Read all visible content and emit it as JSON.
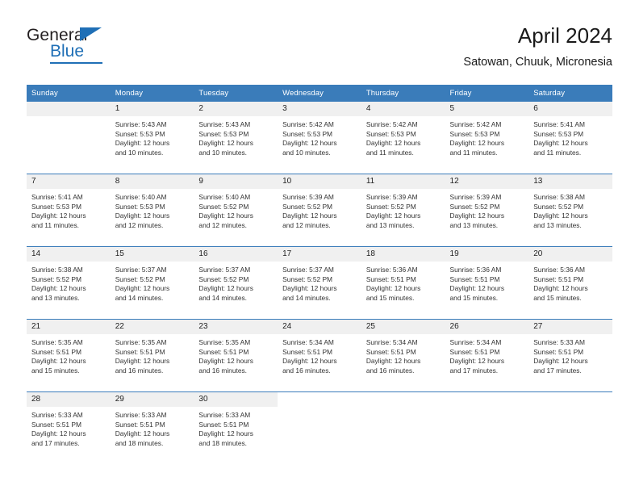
{
  "brand": {
    "word_top": "General",
    "word_bottom": "Blue",
    "triangle_color": "#1f6fb6"
  },
  "header": {
    "title": "April 2024",
    "subtitle": "Satowan, Chuuk, Micronesia"
  },
  "theme": {
    "header_blue": "#3a7cba",
    "daynum_band": "#f0f0f0",
    "text": "#222222"
  },
  "weekdays": [
    "Sunday",
    "Monday",
    "Tuesday",
    "Wednesday",
    "Thursday",
    "Friday",
    "Saturday"
  ],
  "weeks": [
    [
      {
        "day": "",
        "sunrise": "",
        "sunset": "",
        "daylight_line1": "",
        "daylight_line2": "",
        "empty": true
      },
      {
        "day": "1",
        "sunrise": "Sunrise: 5:43 AM",
        "sunset": "Sunset: 5:53 PM",
        "daylight_line1": "Daylight: 12 hours",
        "daylight_line2": "and 10 minutes."
      },
      {
        "day": "2",
        "sunrise": "Sunrise: 5:43 AM",
        "sunset": "Sunset: 5:53 PM",
        "daylight_line1": "Daylight: 12 hours",
        "daylight_line2": "and 10 minutes."
      },
      {
        "day": "3",
        "sunrise": "Sunrise: 5:42 AM",
        "sunset": "Sunset: 5:53 PM",
        "daylight_line1": "Daylight: 12 hours",
        "daylight_line2": "and 10 minutes."
      },
      {
        "day": "4",
        "sunrise": "Sunrise: 5:42 AM",
        "sunset": "Sunset: 5:53 PM",
        "daylight_line1": "Daylight: 12 hours",
        "daylight_line2": "and 11 minutes."
      },
      {
        "day": "5",
        "sunrise": "Sunrise: 5:42 AM",
        "sunset": "Sunset: 5:53 PM",
        "daylight_line1": "Daylight: 12 hours",
        "daylight_line2": "and 11 minutes."
      },
      {
        "day": "6",
        "sunrise": "Sunrise: 5:41 AM",
        "sunset": "Sunset: 5:53 PM",
        "daylight_line1": "Daylight: 12 hours",
        "daylight_line2": "and 11 minutes."
      }
    ],
    [
      {
        "day": "7",
        "sunrise": "Sunrise: 5:41 AM",
        "sunset": "Sunset: 5:53 PM",
        "daylight_line1": "Daylight: 12 hours",
        "daylight_line2": "and 11 minutes."
      },
      {
        "day": "8",
        "sunrise": "Sunrise: 5:40 AM",
        "sunset": "Sunset: 5:53 PM",
        "daylight_line1": "Daylight: 12 hours",
        "daylight_line2": "and 12 minutes."
      },
      {
        "day": "9",
        "sunrise": "Sunrise: 5:40 AM",
        "sunset": "Sunset: 5:52 PM",
        "daylight_line1": "Daylight: 12 hours",
        "daylight_line2": "and 12 minutes."
      },
      {
        "day": "10",
        "sunrise": "Sunrise: 5:39 AM",
        "sunset": "Sunset: 5:52 PM",
        "daylight_line1": "Daylight: 12 hours",
        "daylight_line2": "and 12 minutes."
      },
      {
        "day": "11",
        "sunrise": "Sunrise: 5:39 AM",
        "sunset": "Sunset: 5:52 PM",
        "daylight_line1": "Daylight: 12 hours",
        "daylight_line2": "and 13 minutes."
      },
      {
        "day": "12",
        "sunrise": "Sunrise: 5:39 AM",
        "sunset": "Sunset: 5:52 PM",
        "daylight_line1": "Daylight: 12 hours",
        "daylight_line2": "and 13 minutes."
      },
      {
        "day": "13",
        "sunrise": "Sunrise: 5:38 AM",
        "sunset": "Sunset: 5:52 PM",
        "daylight_line1": "Daylight: 12 hours",
        "daylight_line2": "and 13 minutes."
      }
    ],
    [
      {
        "day": "14",
        "sunrise": "Sunrise: 5:38 AM",
        "sunset": "Sunset: 5:52 PM",
        "daylight_line1": "Daylight: 12 hours",
        "daylight_line2": "and 13 minutes."
      },
      {
        "day": "15",
        "sunrise": "Sunrise: 5:37 AM",
        "sunset": "Sunset: 5:52 PM",
        "daylight_line1": "Daylight: 12 hours",
        "daylight_line2": "and 14 minutes."
      },
      {
        "day": "16",
        "sunrise": "Sunrise: 5:37 AM",
        "sunset": "Sunset: 5:52 PM",
        "daylight_line1": "Daylight: 12 hours",
        "daylight_line2": "and 14 minutes."
      },
      {
        "day": "17",
        "sunrise": "Sunrise: 5:37 AM",
        "sunset": "Sunset: 5:52 PM",
        "daylight_line1": "Daylight: 12 hours",
        "daylight_line2": "and 14 minutes."
      },
      {
        "day": "18",
        "sunrise": "Sunrise: 5:36 AM",
        "sunset": "Sunset: 5:51 PM",
        "daylight_line1": "Daylight: 12 hours",
        "daylight_line2": "and 15 minutes."
      },
      {
        "day": "19",
        "sunrise": "Sunrise: 5:36 AM",
        "sunset": "Sunset: 5:51 PM",
        "daylight_line1": "Daylight: 12 hours",
        "daylight_line2": "and 15 minutes."
      },
      {
        "day": "20",
        "sunrise": "Sunrise: 5:36 AM",
        "sunset": "Sunset: 5:51 PM",
        "daylight_line1": "Daylight: 12 hours",
        "daylight_line2": "and 15 minutes."
      }
    ],
    [
      {
        "day": "21",
        "sunrise": "Sunrise: 5:35 AM",
        "sunset": "Sunset: 5:51 PM",
        "daylight_line1": "Daylight: 12 hours",
        "daylight_line2": "and 15 minutes."
      },
      {
        "day": "22",
        "sunrise": "Sunrise: 5:35 AM",
        "sunset": "Sunset: 5:51 PM",
        "daylight_line1": "Daylight: 12 hours",
        "daylight_line2": "and 16 minutes."
      },
      {
        "day": "23",
        "sunrise": "Sunrise: 5:35 AM",
        "sunset": "Sunset: 5:51 PM",
        "daylight_line1": "Daylight: 12 hours",
        "daylight_line2": "and 16 minutes."
      },
      {
        "day": "24",
        "sunrise": "Sunrise: 5:34 AM",
        "sunset": "Sunset: 5:51 PM",
        "daylight_line1": "Daylight: 12 hours",
        "daylight_line2": "and 16 minutes."
      },
      {
        "day": "25",
        "sunrise": "Sunrise: 5:34 AM",
        "sunset": "Sunset: 5:51 PM",
        "daylight_line1": "Daylight: 12 hours",
        "daylight_line2": "and 16 minutes."
      },
      {
        "day": "26",
        "sunrise": "Sunrise: 5:34 AM",
        "sunset": "Sunset: 5:51 PM",
        "daylight_line1": "Daylight: 12 hours",
        "daylight_line2": "and 17 minutes."
      },
      {
        "day": "27",
        "sunrise": "Sunrise: 5:33 AM",
        "sunset": "Sunset: 5:51 PM",
        "daylight_line1": "Daylight: 12 hours",
        "daylight_line2": "and 17 minutes."
      }
    ],
    [
      {
        "day": "28",
        "sunrise": "Sunrise: 5:33 AM",
        "sunset": "Sunset: 5:51 PM",
        "daylight_line1": "Daylight: 12 hours",
        "daylight_line2": "and 17 minutes."
      },
      {
        "day": "29",
        "sunrise": "Sunrise: 5:33 AM",
        "sunset": "Sunset: 5:51 PM",
        "daylight_line1": "Daylight: 12 hours",
        "daylight_line2": "and 18 minutes."
      },
      {
        "day": "30",
        "sunrise": "Sunrise: 5:33 AM",
        "sunset": "Sunset: 5:51 PM",
        "daylight_line1": "Daylight: 12 hours",
        "daylight_line2": "and 18 minutes."
      },
      {
        "day": "",
        "sunrise": "",
        "sunset": "",
        "daylight_line1": "",
        "daylight_line2": "",
        "blank": true
      },
      {
        "day": "",
        "sunrise": "",
        "sunset": "",
        "daylight_line1": "",
        "daylight_line2": "",
        "blank": true
      },
      {
        "day": "",
        "sunrise": "",
        "sunset": "",
        "daylight_line1": "",
        "daylight_line2": "",
        "blank": true
      },
      {
        "day": "",
        "sunrise": "",
        "sunset": "",
        "daylight_line1": "",
        "daylight_line2": "",
        "blank": true
      }
    ]
  ]
}
